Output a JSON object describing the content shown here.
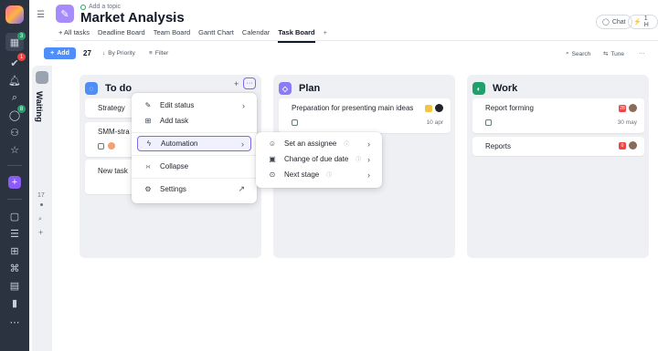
{
  "rail": {
    "badges": [
      "3",
      "1",
      "8"
    ],
    "add_label": "+"
  },
  "header": {
    "topic": "Add a topic",
    "title": "Market Analysis",
    "chat": "Chat",
    "timer": "1 H"
  },
  "tabs": [
    {
      "label": "+ All tasks",
      "active": false
    },
    {
      "label": "Deadline Board",
      "active": false
    },
    {
      "label": "Team Board",
      "active": false
    },
    {
      "label": "Gantt Chart",
      "active": false
    },
    {
      "label": "Calendar",
      "active": false
    },
    {
      "label": "Task Board",
      "active": true
    },
    {
      "label": "+",
      "active": false
    }
  ],
  "toolbar": {
    "add": "Add",
    "count": "27",
    "by_priority": "By Priority",
    "filter": "Filter",
    "search": "Search",
    "tune": "Tune",
    "more": "···"
  },
  "waiting": {
    "label": "Waiting",
    "count": "17"
  },
  "columns": {
    "todo": {
      "title": "To do",
      "color": "#4f8ef7",
      "cards": [
        "Strategy",
        "SMM-stra",
        "New task"
      ]
    },
    "plan": {
      "title": "Plan",
      "color": "#8b7cf6",
      "card": {
        "title": "Preparation for presenting main ideas",
        "date": "10 apr"
      }
    },
    "work": {
      "title": "Work",
      "color": "#22a06b",
      "card1": {
        "title": "Report forming",
        "date": "30 may",
        "tag": "28"
      },
      "card2": {
        "title": "Reports",
        "tag": "0"
      }
    }
  },
  "menu": {
    "edit_status": "Edit status",
    "add_task": "Add task",
    "automation": "Automation",
    "collapse": "Collapse",
    "settings": "Settings"
  },
  "submenu": {
    "set_assignee": "Set an assignee",
    "change_due": "Change of due date",
    "next_stage": "Next stage"
  }
}
